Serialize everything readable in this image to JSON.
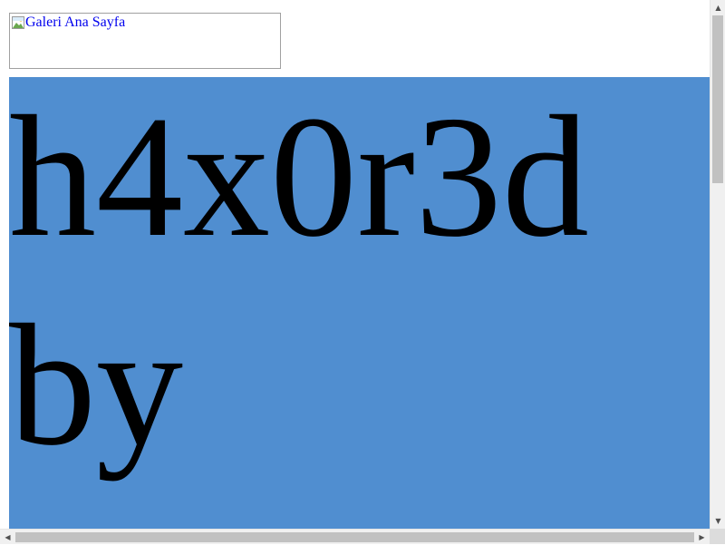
{
  "header": {
    "logo_alt": "Galeri Ana Sayfa",
    "logo_icon": "broken-image-icon"
  },
  "hero": {
    "text": "h4x0r3d by",
    "background_color": "#508ed0"
  },
  "scrollbars": {
    "up_arrow": "▲",
    "down_arrow": "▼",
    "left_arrow": "◀",
    "right_arrow": "▶"
  }
}
